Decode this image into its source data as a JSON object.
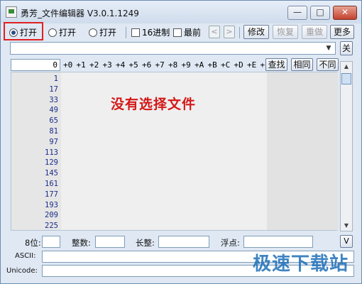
{
  "window": {
    "title": "勇芳_文件编辑器 V3.0.1.1249",
    "min_icon": "minimize-icon",
    "max_icon": "maximize-icon",
    "close_icon": "close-icon"
  },
  "toolbar": {
    "radios": [
      {
        "label": "打开",
        "checked": true
      },
      {
        "label": "打开",
        "checked": false
      },
      {
        "label": "打开",
        "checked": false
      }
    ],
    "checks": [
      {
        "label": "16进制",
        "checked": false
      },
      {
        "label": "最前",
        "checked": false
      }
    ],
    "prev": "<",
    "next": ">",
    "modify": "修改",
    "restore": "恢复",
    "redo": "重做",
    "more": "更多"
  },
  "combo": {
    "value": "",
    "arrow": "▼"
  },
  "close_btn": "关",
  "hex": {
    "offset": "0",
    "columns": [
      "+0",
      "+1",
      "+2",
      "+3",
      "+4",
      "+5",
      "+6",
      "+7",
      "+8",
      "+9",
      "+A",
      "+B",
      "+C",
      "+D",
      "+E",
      "+F"
    ],
    "find": "查找",
    "same": "相同",
    "diff": "不同",
    "addresses": [
      "1",
      "17",
      "33",
      "49",
      "65",
      "81",
      "97",
      "113",
      "129",
      "145",
      "161",
      "177",
      "193",
      "209",
      "225"
    ],
    "message": "没有选择文件"
  },
  "scrollbar": {
    "up": "▲",
    "down": "▼"
  },
  "status": {
    "bit8": "8位:",
    "integer": "整数:",
    "long": "长整:",
    "float": "浮点:",
    "ascii": "ASCII:",
    "unicode": "Unicode:",
    "v_button": "V"
  },
  "watermark": {
    "text": "极速下载站"
  }
}
